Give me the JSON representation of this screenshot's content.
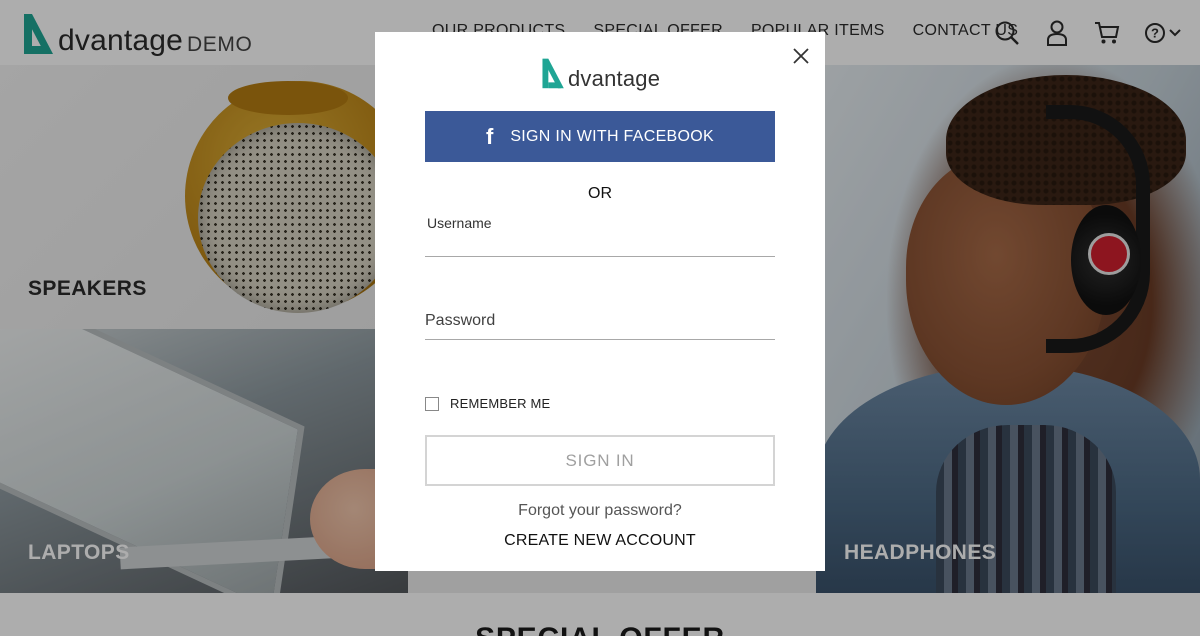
{
  "header": {
    "brand": {
      "word": "dvantage",
      "suffix": "DEMO"
    },
    "nav": [
      "OUR PRODUCTS",
      "SPECIAL OFFER",
      "POPULAR ITEMS",
      "CONTACT US"
    ],
    "icons": [
      "search-icon",
      "user-icon",
      "cart-icon",
      "help-icon",
      "chevron-down-icon"
    ]
  },
  "tiles": {
    "speakers": "SPEAKERS",
    "laptops": "LAPTOPS",
    "headphones": "HEADPHONES"
  },
  "section": {
    "title": "SPECIAL OFFER"
  },
  "modal": {
    "logo_word": "dvantage",
    "facebook_label": "SIGN IN WITH FACEBOOK",
    "facebook_icon": "f",
    "or": "OR",
    "username_label": "Username",
    "username_value": "",
    "password_label": "Password",
    "password_value": "",
    "remember_label": "REMEMBER ME",
    "remember_checked": false,
    "signin_label": "SIGN IN",
    "forgot_label": "Forgot your password?",
    "create_label": "CREATE NEW ACCOUNT"
  },
  "colors": {
    "brand_teal": "#1fa594",
    "facebook_blue": "#3b5998",
    "overlay": "rgba(0,0,0,0.32)"
  }
}
